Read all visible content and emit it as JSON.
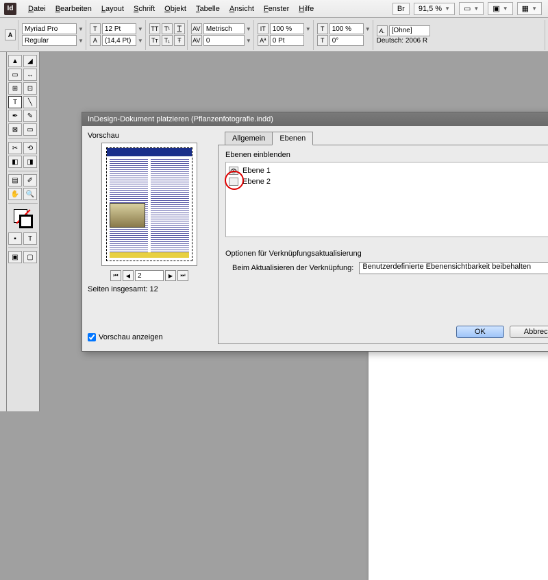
{
  "menubar": {
    "items": [
      "Datei",
      "Bearbeiten",
      "Layout",
      "Schrift",
      "Objekt",
      "Tabelle",
      "Ansicht",
      "Fenster",
      "Hilfe"
    ],
    "br_label": "Br",
    "zoom": "91,5 %"
  },
  "controlbar": {
    "font": "Myriad Pro",
    "style": "Regular",
    "size": "12 Pt",
    "leading": "(14,4 Pt)",
    "tracking_unit": "Metrisch",
    "tracking_val": "0",
    "hscale": "100 %",
    "vscale": "100 %",
    "baseline": "0 Pt",
    "skew": "0°",
    "para_style": "[Ohne]",
    "lang": "Deutsch: 2006 R"
  },
  "dialog": {
    "title": "InDesign-Dokument platzieren (Pflanzenfotografie.indd)",
    "preview_label": "Vorschau",
    "page_current": "2",
    "pages_total_label": "Seiten insgesamt: 12",
    "show_preview_label": "Vorschau anzeigen",
    "tabs": {
      "general": "Allgemein",
      "layers": "Ebenen"
    },
    "layers_group_label": "Ebenen einblenden",
    "layers": [
      {
        "name": "Ebene 1",
        "visible": true
      },
      {
        "name": "Ebene 2",
        "visible": false
      }
    ],
    "update_options_label": "Optionen für Verknüpfungsaktualisierung",
    "update_row_label": "Beim Aktualisieren der Verknüpfung:",
    "update_select_value": "Benutzerdefinierte Ebenensichtbarkeit beibehalten",
    "ok": "OK",
    "cancel": "Abbrechen"
  }
}
